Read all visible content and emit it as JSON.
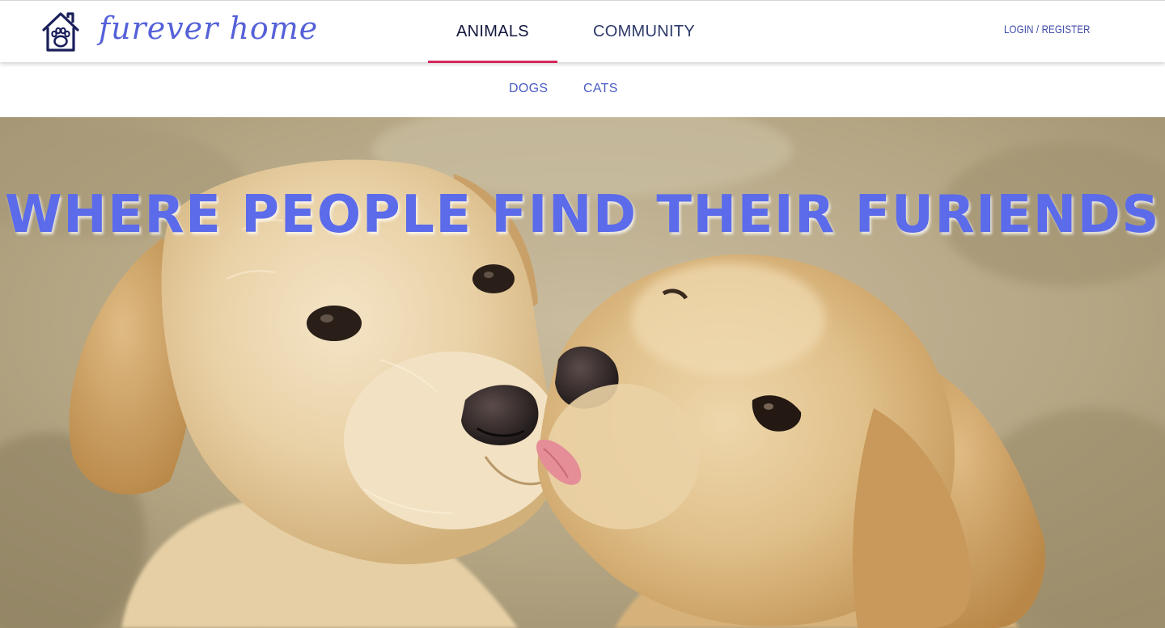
{
  "brand": {
    "name": "furever home",
    "logo_icon": "house-paw-icon",
    "color": "#5561d8"
  },
  "nav": {
    "tabs": [
      {
        "label": "ANIMALS",
        "active": true
      },
      {
        "label": "COMMUNITY",
        "active": false
      }
    ],
    "login_label": "LOGIN / REGISTER",
    "active_underline_color": "#d7265b"
  },
  "subnav": {
    "items": [
      {
        "label": "DOGS"
      },
      {
        "label": "CATS"
      }
    ]
  },
  "hero": {
    "title": "WHERE PEOPLE FIND THEIR FURIENDS",
    "title_color": "#5b6bea",
    "image": "two-labrador-puppies-kissing"
  }
}
